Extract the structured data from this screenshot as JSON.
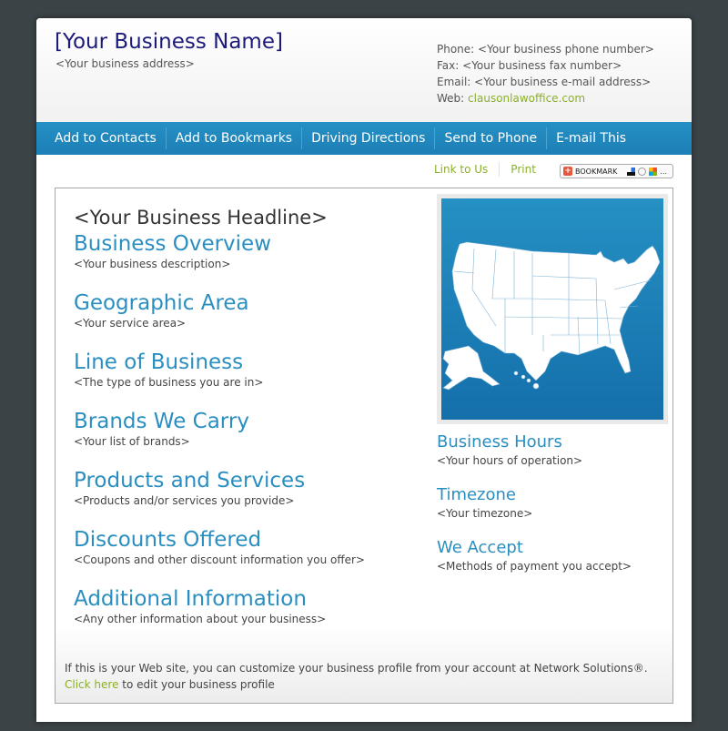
{
  "header": {
    "business_name": "[Your Business Name]",
    "business_address": "<Your business address>",
    "contact": {
      "phone_label": "Phone:",
      "phone_value": "<Your business phone number>",
      "fax_label": "Fax:",
      "fax_value": "<Your business fax number>",
      "email_label": "Email:",
      "email_value": "<Your business e-mail address>",
      "web_label": "Web:",
      "web_value": "clausonlawoffice.com"
    }
  },
  "nav": {
    "items": [
      {
        "label": "Add to Contacts"
      },
      {
        "label": "Add to Bookmarks"
      },
      {
        "label": "Driving Directions"
      },
      {
        "label": "Send to Phone"
      },
      {
        "label": "E-mail This"
      }
    ]
  },
  "utility": {
    "link_to_us": "Link to Us",
    "print": "Print",
    "bookmark_button": "BOOKMARK",
    "bookmark_more": "..."
  },
  "main": {
    "headline": "<Your Business Headline>",
    "sections": [
      {
        "title": "Business Overview",
        "text": "<Your business description>"
      },
      {
        "title": "Geographic Area",
        "text": "<Your service area>"
      },
      {
        "title": "Line of Business",
        "text": "<The type of business you are in>"
      },
      {
        "title": "Brands We Carry",
        "text": "<Your list of brands>"
      },
      {
        "title": "Products and Services",
        "text": "<Products and/or services you provide>"
      },
      {
        "title": "Discounts Offered",
        "text": "<Coupons and other discount information you offer>"
      },
      {
        "title": "Additional Information",
        "text": "<Any other information about your business>"
      }
    ]
  },
  "sidebar": {
    "map_icon": "us-map-icon",
    "sections": [
      {
        "title": "Business Hours",
        "text": "<Your hours of operation>"
      },
      {
        "title": "Timezone",
        "text": "<Your timezone>"
      },
      {
        "title": "We Accept",
        "text": "<Methods of payment you accept>"
      }
    ]
  },
  "footer": {
    "note": "If this is your Web site, you can customize your business profile from your account at Network Solutions®.",
    "click_here": "Click here",
    "edit_text": " to edit your business profile"
  },
  "colors": {
    "background": "#3b4346",
    "accent_blue": "#2a8fc0",
    "nav_blue": "#2590c4",
    "link_green": "#8ab02a",
    "title_navy": "#1c1a7a"
  }
}
